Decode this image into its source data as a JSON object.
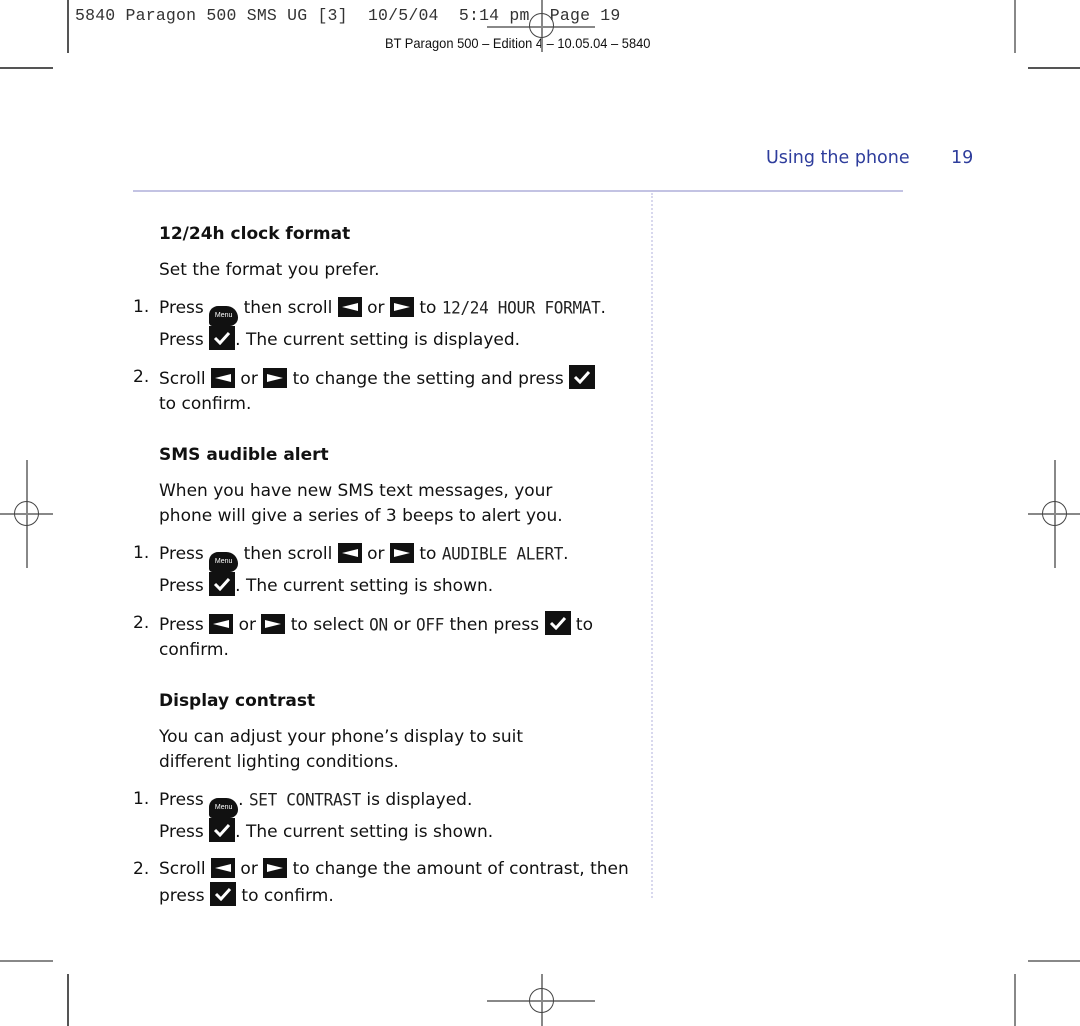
{
  "print_slug": "5840 Paragon 500 SMS UG [3]  10/5/04  5:14 pm  Page 19",
  "edition_line": "BT Paragon 500 – Edition 4 – 10.05.04 – 5840",
  "header": {
    "running_head": "Using the phone",
    "page_number": "19",
    "accent_color": "#2e3d9c",
    "rule_color": "#c3c3e3"
  },
  "icons": {
    "menu_key": "Menu",
    "scroll_left": "scroll-left-key",
    "scroll_right": "scroll-right-key",
    "ok_key": "check-mark-key"
  },
  "sections": [
    {
      "title": "12/24h clock format",
      "intro": "Set the format you prefer.",
      "steps": [
        {
          "num": "1.",
          "press": "Press",
          "then_scroll": "then scroll",
          "or": "or",
          "to": "to",
          "lcd": "12/24 HOUR FORMAT",
          "period": ".",
          "press2": "Press",
          "rest": ". The current setting is displayed."
        },
        {
          "num": "2.",
          "scroll": "Scroll",
          "or": "or",
          "mid": "to change the setting and press",
          "end": "to confirm."
        }
      ]
    },
    {
      "title": "SMS audible alert",
      "intro": "When you have new SMS text messages, your phone will give a series of 3 beeps to alert you.",
      "steps": [
        {
          "num": "1.",
          "press": "Press",
          "then_scroll": "then scroll",
          "or": "or",
          "to": "to",
          "lcd": "AUDIBLE ALERT",
          "period": ".",
          "press2": "Press",
          "rest": ". The current setting is shown."
        },
        {
          "num": "2.",
          "press": "Press",
          "or": "or",
          "to_select": "to select",
          "lcd_on": "ON",
          "or2": "or",
          "lcd_off": "OFF",
          "then_press": "then press",
          "end": "to confirm."
        }
      ]
    },
    {
      "title": "Display contrast",
      "intro": "You can adjust your phone’s display to suit different lighting conditions.",
      "steps": [
        {
          "num": "1.",
          "press": "Press",
          "period": ".",
          "lcd": "SET CONTRAST",
          "is_displayed": "is displayed.",
          "press2": "Press",
          "rest": ". The current setting is shown."
        },
        {
          "num": "2.",
          "scroll": "Scroll",
          "or": "or",
          "mid": "to change the amount of contrast, then press",
          "end": "to confirm."
        }
      ]
    }
  ]
}
